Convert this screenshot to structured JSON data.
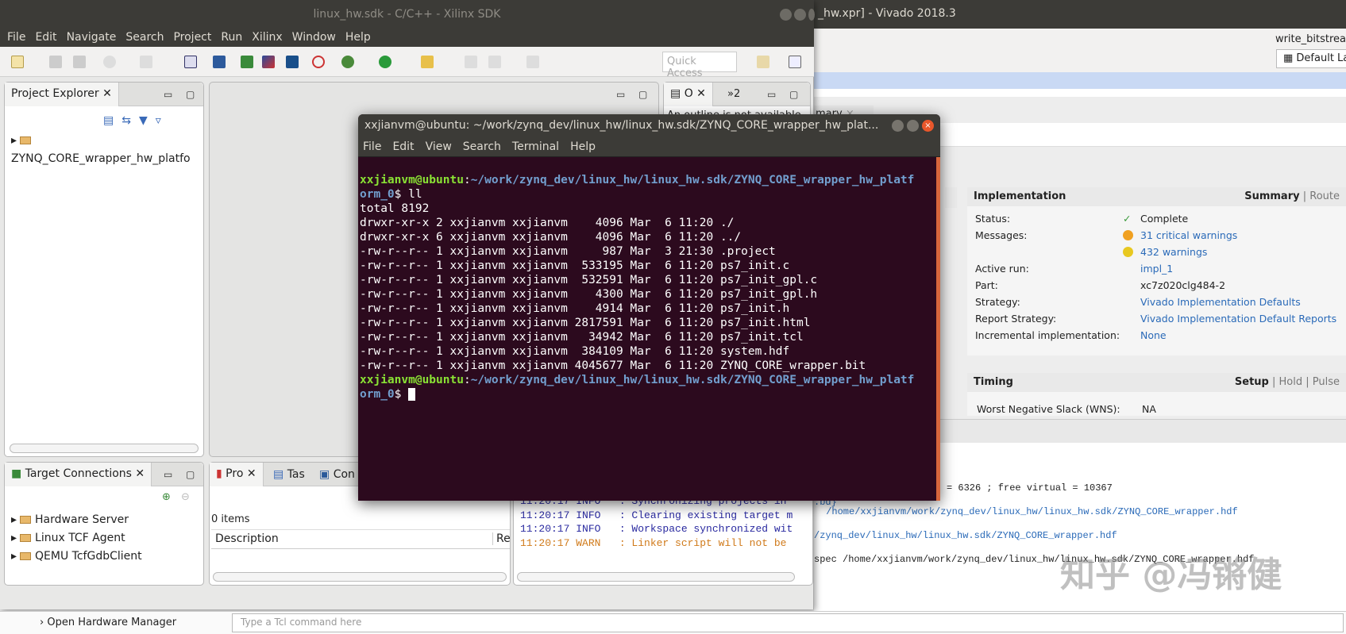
{
  "vivado": {
    "title": "_hw.xpr] - Vivado 2018.3",
    "run_label": "write_bitstrea",
    "layout": "Default Lay",
    "summary_tab": "mary",
    "impl": {
      "title": "Implementation",
      "tabs": [
        "Summary",
        "Route"
      ],
      "rows": [
        {
          "label": "Status:",
          "value": "Complete"
        },
        {
          "label": "Messages:",
          "value": "31 critical warnings"
        },
        {
          "label": "",
          "value": "432 warnings"
        },
        {
          "label": "Active run:",
          "value": "impl_1"
        },
        {
          "label": "Part:",
          "value": "xc7z020clg484-2"
        },
        {
          "label": "Strategy:",
          "value": "Vivado Implementation Defaults"
        },
        {
          "label": "Report Strategy:",
          "value": "Vivado Implementation Default Reports"
        },
        {
          "label": "Incremental implementation:",
          "value": "None"
        }
      ]
    },
    "timing": {
      "title": "Timing",
      "tabs": [
        "Setup",
        "Hold",
        "Pulse"
      ],
      "first_row": "Worst Negative Slack (WNS):",
      "first_val": "NA"
    },
    "tcl_lines": [
      "= 6326 ; free virtual = 10367",
      ".bd}",
      " /home/xxjianvm/work/zynq_dev/linux_hw/linux_hw.sdk/ZYNQ_CORE_wrapper.hdf",
      "/zynq_dev/linux_hw/linux_hw.sdk/ZYNQ_CORE_wrapper.hdf",
      "spec /home/xxjianvm/work/zynq_dev/linux_hw/linux_hw.sdk/ZYNQ_CORE_wrapper.hdf"
    ],
    "open_hw": "Open Hardware Manager",
    "tcl_placeholder": "Type a Tcl command here",
    "watermark": "知乎 @冯锵健"
  },
  "sdk": {
    "title": "linux_hw.sdk - C/C++ - Xilinx SDK",
    "menu": [
      "File",
      "Edit",
      "Navigate",
      "Search",
      "Project",
      "Run",
      "Xilinx",
      "Window",
      "Help"
    ],
    "quick_access": "Quick Access",
    "project_explorer": {
      "tab": "Project Explorer",
      "items": [
        "ZYNQ_CORE_wrapper_hw_platfo"
      ]
    },
    "outline": {
      "tab": "O",
      "tab2": "»2",
      "message": "An outline is not available."
    },
    "target": {
      "tab": "Target Connections",
      "items": [
        "Hardware Server",
        "Linux TCF Agent",
        "QEMU TcfGdbClient"
      ]
    },
    "problems": {
      "tabs": [
        "Pro",
        "Tas",
        "Con"
      ],
      "count": "0 items",
      "columns": [
        "Description",
        "Re"
      ]
    },
    "console": [
      "11:20:17 INFO   : Synchronizing projects in",
      "11:20:17 INFO   : Clearing existing target m",
      "11:20:17 INFO   : Workspace synchronized wit",
      "11:20:17 WARN   : Linker script will not be"
    ]
  },
  "terminal": {
    "title": "xxjianvm@ubuntu: ~/work/zynq_dev/linux_hw/linux_hw.sdk/ZYNQ_CORE_wrapper_hw_plat...",
    "menu": [
      "File",
      "Edit",
      "View",
      "Search",
      "Terminal",
      "Help"
    ],
    "prompt_user": "xxjianvm@ubuntu",
    "prompt_path": "~/work/zynq_dev/linux_hw/linux_hw.sdk/ZYNQ_CORE_wrapper_hw_platf",
    "prompt_path2": "orm_0",
    "command": "ll",
    "output": [
      "total 8192",
      "drwxr-xr-x 2 xxjianvm xxjianvm    4096 Mar  6 11:20 ./",
      "drwxr-xr-x 6 xxjianvm xxjianvm    4096 Mar  6 11:20 ../",
      "-rw-r--r-- 1 xxjianvm xxjianvm     987 Mar  3 21:30 .project",
      "-rw-r--r-- 1 xxjianvm xxjianvm  533195 Mar  6 11:20 ps7_init.c",
      "-rw-r--r-- 1 xxjianvm xxjianvm  532591 Mar  6 11:20 ps7_init_gpl.c",
      "-rw-r--r-- 1 xxjianvm xxjianvm    4300 Mar  6 11:20 ps7_init_gpl.h",
      "-rw-r--r-- 1 xxjianvm xxjianvm    4914 Mar  6 11:20 ps7_init.h",
      "-rw-r--r-- 1 xxjianvm xxjianvm 2817591 Mar  6 11:20 ps7_init.html",
      "-rw-r--r-- 1 xxjianvm xxjianvm   34942 Mar  6 11:20 ps7_init.tcl",
      "-rw-r--r-- 1 xxjianvm xxjianvm  384109 Mar  6 11:20 system.hdf",
      "-rw-r--r-- 1 xxjianvm xxjianvm 4045677 Mar  6 11:20 ZYNQ_CORE_wrapper.bit"
    ]
  }
}
